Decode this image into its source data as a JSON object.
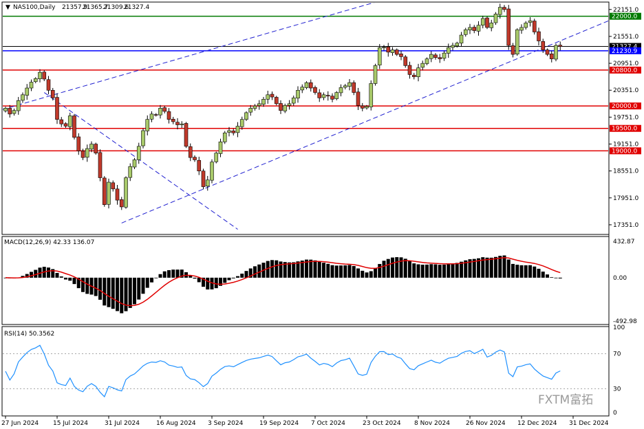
{
  "chart_data": {
    "type": "candlestick",
    "header": {
      "symbol_label": "NAS100,Daily",
      "ohlc": [
        "21357.9",
        "21365.7",
        "21309.6",
        "21327.4"
      ]
    },
    "price_axis": {
      "min": 17151,
      "max": 22301,
      "ticks": [
        "22151.0",
        "21551.0",
        "20951.0",
        "20351.0",
        "19751.0",
        "19151.0",
        "18551.0",
        "17951.0",
        "17351.0"
      ]
    },
    "x_axis_labels": [
      {
        "label": "27 Jun 2024",
        "index": 0
      },
      {
        "label": "15 Jul 2024",
        "index": 12
      },
      {
        "label": "31 Jul 2024",
        "index": 24
      },
      {
        "label": "16 Aug 2024",
        "index": 36
      },
      {
        "label": "3 Sep 2024",
        "index": 48
      },
      {
        "label": "19 Sep 2024",
        "index": 60
      },
      {
        "label": "7 Oct 2024",
        "index": 72
      },
      {
        "label": "23 Oct 2024",
        "index": 84
      },
      {
        "label": "8 Nov 2024",
        "index": 96
      },
      {
        "label": "26 Nov 2024",
        "index": 108
      },
      {
        "label": "12 Dec 2024",
        "index": 120
      },
      {
        "label": "31 Dec 2024",
        "index": 132
      }
    ],
    "horizontal_lines": [
      {
        "price": 22000.0,
        "label": "22000.0",
        "color": "#007a00"
      },
      {
        "price": 21327.4,
        "label": "21327.4",
        "color": "#000000"
      },
      {
        "price": 21230.9,
        "label": "21230.9",
        "color": "#0000ff"
      },
      {
        "price": 20800.0,
        "label": "20800.0",
        "color": "#e00000"
      },
      {
        "price": 20000.0,
        "label": "20000.0",
        "color": "#e00000"
      },
      {
        "price": 19500.0,
        "label": "19500.0",
        "color": "#e00000"
      },
      {
        "price": 19000.0,
        "label": "19000.0",
        "color": "#e00000"
      }
    ],
    "trendlines": [
      {
        "name": "channel-upper",
        "from": [
          0,
          19940
        ],
        "to": [
          100,
          22700
        ]
      },
      {
        "name": "channel-lower",
        "from": [
          27,
          17390
        ],
        "to": [
          137,
          21770
        ]
      },
      {
        "name": "descending-line",
        "from": [
          9,
          20300
        ],
        "to": [
          54,
          17250
        ]
      }
    ],
    "closes": [
      19950,
      19820,
      19900,
      20120,
      20250,
      20400,
      20530,
      20610,
      20750,
      20600,
      20350,
      20180,
      19700,
      19600,
      19550,
      19780,
      19300,
      19000,
      18850,
      19050,
      19150,
      18950,
      18400,
      17800,
      18300,
      18150,
      17900,
      17750,
      18400,
      18650,
      18800,
      19100,
      19450,
      19700,
      19820,
      19800,
      19950,
      19880,
      19700,
      19650,
      19580,
      19600,
      19100,
      18850,
      18800,
      18550,
      18200,
      18350,
      18750,
      18950,
      19200,
      19400,
      19450,
      19400,
      19550,
      19700,
      19850,
      19950,
      20000,
      20050,
      20150,
      20250,
      20200,
      20050,
      19900,
      20010,
      20050,
      20180,
      20350,
      20420,
      20520,
      20400,
      20300,
      20180,
      20250,
      20220,
      20150,
      20300,
      20410,
      20450,
      20520,
      20300,
      20010,
      19950,
      19990,
      20500,
      20900,
      21300,
      21310,
      21200,
      21250,
      21150,
      21100,
      20900,
      20700,
      20650,
      20850,
      20950,
      21050,
      21150,
      21080,
      21050,
      21180,
      21300,
      21350,
      21400,
      21580,
      21700,
      21750,
      21680,
      21800,
      21950,
      21750,
      21850,
      22050,
      22200,
      22151,
      21350,
      21150,
      21700,
      21750,
      21850,
      21900,
      21650,
      21450,
      21250,
      21150,
      21050,
      21350,
      21327
    ],
    "macd": {
      "label": "MACD(12,26,9) 42.33 136.07",
      "ticks": [
        "432.87",
        "0.00",
        "-492.98"
      ],
      "max": 432.87,
      "min": -492.98,
      "main": 42.33,
      "signal": 136.07
    },
    "rsi": {
      "label": "RSI(14) 50.3562",
      "ticks": [
        "100",
        "70",
        "30",
        "0"
      ],
      "levels": [
        70,
        30
      ],
      "value": 50.3562
    },
    "watermark": "FXTM富拓"
  }
}
